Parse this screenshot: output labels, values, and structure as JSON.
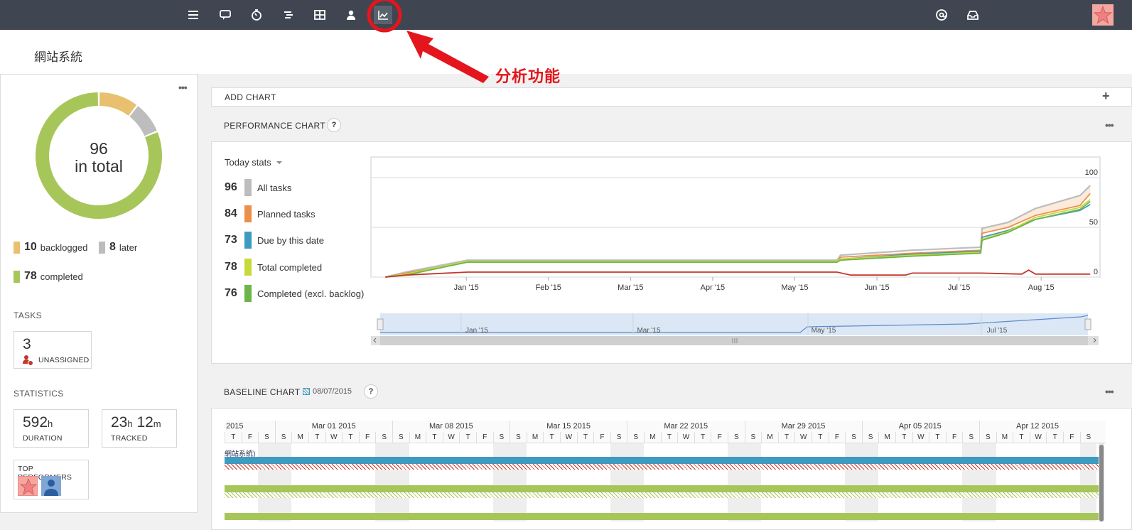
{
  "nav": {
    "icons": [
      "menu-icon",
      "discussion-icon",
      "timer-icon",
      "outline-icon",
      "table-icon",
      "user-icon",
      "analytics-icon"
    ],
    "right_icons": [
      "mention-icon",
      "inbox-icon"
    ]
  },
  "project_title": "網站系統",
  "annotation": {
    "label": "分析功能",
    "color": "#e4151c"
  },
  "summary": {
    "total_number": "96",
    "total_label": "in total",
    "legend": [
      {
        "count": "10",
        "label": "backlogged",
        "color": "#e8c06f"
      },
      {
        "count": "8",
        "label": "later",
        "color": "#bdbdbd"
      },
      {
        "count": "78",
        "label": "completed",
        "color": "#a7c65a"
      }
    ],
    "donut": {
      "backlogged": 10,
      "later": 8,
      "completed": 78
    }
  },
  "tasks": {
    "label": "TASKS",
    "unassigned_count": "3",
    "unassigned_label": "UNASSIGNED"
  },
  "statistics": {
    "label": "STATISTICS",
    "duration_value": "592",
    "duration_unit": "h",
    "duration_label": "DURATION",
    "tracked_hours": "23",
    "tracked_h_unit": "h",
    "tracked_minutes": "12",
    "tracked_m_unit": "m",
    "tracked_label": "TRACKED",
    "top_performers_label": "TOP PERFORMERS"
  },
  "add_chart": {
    "label": "ADD CHART",
    "plus": "+"
  },
  "performance": {
    "title": "PERFORMANCE CHART",
    "help": "?",
    "filter_label": "Today stats",
    "stats": [
      {
        "value": "96",
        "label": "All tasks",
        "color": "#bdbdbd"
      },
      {
        "value": "84",
        "label": "Planned tasks",
        "color": "#ec8f4b"
      },
      {
        "value": "73",
        "label": "Due by this date",
        "color": "#3d9ac0"
      },
      {
        "value": "78",
        "label": "Total completed",
        "color": "#c8d93a"
      },
      {
        "value": "76",
        "label": "Completed (excl. backlog)",
        "color": "#6db54b"
      }
    ]
  },
  "chart_data": {
    "type": "line",
    "x_ticks": [
      "Jan '15",
      "Feb '15",
      "Mar '15",
      "Apr '15",
      "May '15",
      "Jun '15",
      "Jul '15",
      "Aug '15"
    ],
    "y_ticks": [
      "100",
      "50",
      "0"
    ],
    "ylim": [
      0,
      120
    ],
    "navigator_ticks": [
      "Jan '15",
      "Mar '15",
      "May '15",
      "Jul '15"
    ],
    "series": [
      {
        "name": "All tasks",
        "color": "#bdbdbd",
        "values": [
          [
            0,
            0
          ],
          [
            0.3,
            5
          ],
          [
            1.2,
            17
          ],
          [
            6.6,
            17
          ],
          [
            6.65,
            22
          ],
          [
            7.7,
            27
          ],
          [
            8.7,
            30
          ],
          [
            8.72,
            49
          ],
          [
            9.1,
            55
          ],
          [
            9.5,
            69
          ],
          [
            10.15,
            82
          ],
          [
            10.3,
            92
          ]
        ]
      },
      {
        "name": "Planned tasks",
        "color": "#ec8f4b",
        "values": [
          [
            0,
            0
          ],
          [
            0.3,
            4
          ],
          [
            1.2,
            15
          ],
          [
            6.6,
            15
          ],
          [
            6.65,
            20
          ],
          [
            7.7,
            24
          ],
          [
            8.7,
            27
          ],
          [
            8.72,
            44
          ],
          [
            9.1,
            50
          ],
          [
            9.5,
            62
          ],
          [
            10.15,
            72
          ],
          [
            10.3,
            84
          ]
        ]
      },
      {
        "name": "Due by this date",
        "color": "#3d9ac0",
        "values": [
          [
            0,
            0
          ],
          [
            0.3,
            3
          ],
          [
            1.2,
            16
          ],
          [
            6.6,
            16
          ],
          [
            6.65,
            18
          ],
          [
            7.7,
            23
          ],
          [
            8.7,
            26
          ],
          [
            8.72,
            40
          ],
          [
            9.1,
            47
          ],
          [
            9.5,
            58
          ],
          [
            10.15,
            67
          ],
          [
            10.3,
            73
          ]
        ]
      },
      {
        "name": "Total completed",
        "color": "#c8d93a",
        "values": [
          [
            0,
            0
          ],
          [
            0.3,
            3
          ],
          [
            1.2,
            16
          ],
          [
            6.6,
            16
          ],
          [
            6.65,
            18
          ],
          [
            7.7,
            22
          ],
          [
            8.7,
            25
          ],
          [
            8.72,
            38
          ],
          [
            9.1,
            46
          ],
          [
            9.5,
            60
          ],
          [
            10.15,
            70
          ],
          [
            10.3,
            78
          ]
        ]
      },
      {
        "name": "Completed (excl. backlog)",
        "color": "#6db54b",
        "values": [
          [
            0,
            0
          ],
          [
            0.3,
            2
          ],
          [
            1.2,
            15
          ],
          [
            6.6,
            15
          ],
          [
            6.65,
            17
          ],
          [
            7.7,
            21
          ],
          [
            8.7,
            24
          ],
          [
            8.72,
            37
          ],
          [
            9.1,
            45
          ],
          [
            9.5,
            58
          ],
          [
            10.15,
            68
          ],
          [
            10.3,
            76
          ]
        ]
      },
      {
        "color": "#c0392b",
        "values": [
          [
            0,
            0
          ],
          [
            0.3,
            2
          ],
          [
            1.2,
            5
          ],
          [
            6.6,
            5
          ],
          [
            6.8,
            2
          ],
          [
            7.6,
            2
          ],
          [
            7.7,
            4
          ],
          [
            8.7,
            4
          ],
          [
            9.3,
            3
          ],
          [
            9.4,
            7
          ],
          [
            9.5,
            3
          ],
          [
            10.3,
            3
          ]
        ]
      }
    ]
  },
  "baseline": {
    "title": "BASELINE CHART",
    "date": "08/07/2015",
    "help": "?",
    "weeks": [
      "2015",
      "Mar 01 2015",
      "Mar 08 2015",
      "Mar 15 2015",
      "Mar 22 2015",
      "Mar 29 2015",
      "Apr 05 2015",
      "Apr 12 2015"
    ],
    "days": [
      "S",
      "M",
      "T",
      "W",
      "T",
      "F",
      "S"
    ],
    "task_label": "網站系統)"
  }
}
